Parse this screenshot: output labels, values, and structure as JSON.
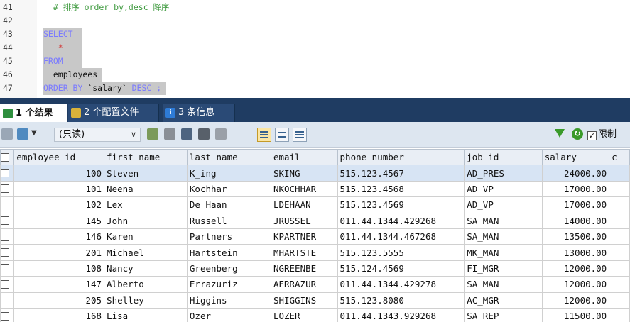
{
  "editor": {
    "lines": [
      {
        "n": "41",
        "text": "  # 排序 order by,desc 降序",
        "style": "cm",
        "selected": false
      },
      {
        "n": "42",
        "text": "",
        "style": "plain",
        "selected": false
      },
      {
        "n": "43",
        "text": "SELECT  ",
        "style": "kw",
        "selected": true
      },
      {
        "n": "44",
        "text": "   *    ",
        "style": "star",
        "selected": true
      },
      {
        "n": "45",
        "text": "FROM    ",
        "style": "kw",
        "selected": true
      },
      {
        "n": "46",
        "text": "  employees ",
        "style": "plain",
        "selected": true
      },
      {
        "n": "47",
        "text": "ORDER BY `salary` DESC ; ",
        "style": "mixed",
        "selected": true
      }
    ],
    "line47": {
      "kw1": "ORDER BY ",
      "ident": "`salary`",
      "kw2": " DESC ;",
      "tail": " "
    }
  },
  "tabs": [
    {
      "label": "1 个结果",
      "icon": "results-grid-icon",
      "active": true
    },
    {
      "label": "2 个配置文件",
      "icon": "profile-icon",
      "active": false
    },
    {
      "label": "3 条信息",
      "icon": "info-icon",
      "active": false
    }
  ],
  "toolbar": {
    "mode": "(只读)",
    "limit_label": "限制",
    "limit_checked": true
  },
  "table": {
    "columns": [
      "",
      "employee_id",
      "first_name",
      "last_name",
      "email",
      "phone_number",
      "job_id",
      "salary",
      "c"
    ],
    "rows": [
      [
        "100",
        "Steven",
        "K_ing",
        "SKING",
        "515.123.4567",
        "AD_PRES",
        "24000.00"
      ],
      [
        "101",
        "Neena",
        "Kochhar",
        "NKOCHHAR",
        "515.123.4568",
        "AD_VP",
        "17000.00"
      ],
      [
        "102",
        "Lex",
        "De Haan",
        "LDEHAAN",
        "515.123.4569",
        "AD_VP",
        "17000.00"
      ],
      [
        "145",
        "John",
        "Russell",
        "JRUSSEL",
        "011.44.1344.429268",
        "SA_MAN",
        "14000.00"
      ],
      [
        "146",
        "Karen",
        "Partners",
        "KPARTNER",
        "011.44.1344.467268",
        "SA_MAN",
        "13500.00"
      ],
      [
        "201",
        "Michael",
        "Hartstein",
        "MHARTSTE",
        "515.123.5555",
        "MK_MAN",
        "13000.00"
      ],
      [
        "108",
        "Nancy",
        "Greenberg",
        "NGREENBE",
        "515.124.4569",
        "FI_MGR",
        "12000.00"
      ],
      [
        "147",
        "Alberto",
        "Errazuriz",
        "AERRAZUR",
        "011.44.1344.429278",
        "SA_MAN",
        "12000.00"
      ],
      [
        "205",
        "Shelley",
        "Higgins",
        "SHIGGINS",
        "515.123.8080",
        "AC_MGR",
        "12000.00"
      ],
      [
        "168",
        "Lisa",
        "Ozer",
        "LOZER",
        "011.44.1343.929268",
        "SA_REP",
        "11500.00"
      ]
    ]
  }
}
